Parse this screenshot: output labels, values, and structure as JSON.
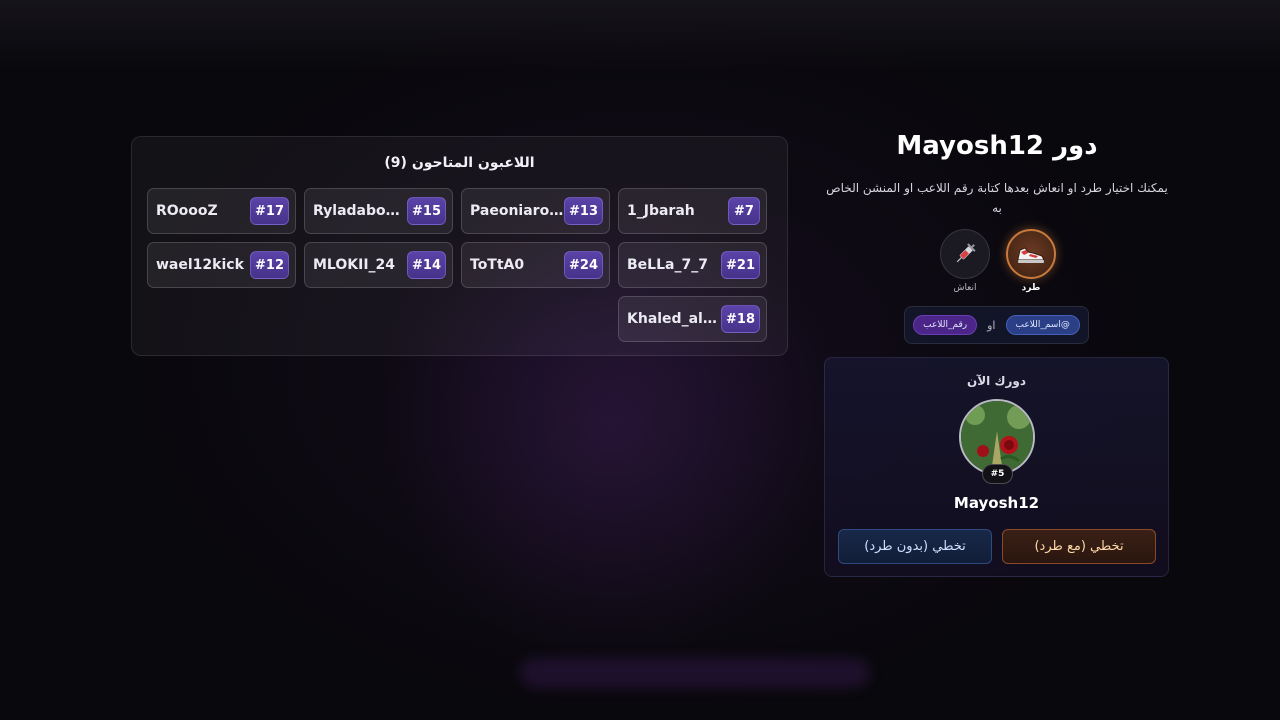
{
  "players_panel": {
    "title": "اللاعبون المتاحون",
    "count": "(9)",
    "players": [
      {
        "name": "1_Jbarah",
        "number": "#7"
      },
      {
        "name": "Paeoniaros…",
        "number": "#13"
      },
      {
        "name": "Ryladaboam…",
        "number": "#15"
      },
      {
        "name": "ROoooZ",
        "number": "#17"
      },
      {
        "name": "BeLLa_7_7",
        "number": "#21"
      },
      {
        "name": "ToTtA0",
        "number": "#24"
      },
      {
        "name": "MLOKII_24",
        "number": "#14"
      },
      {
        "name": "wael12kick",
        "number": "#12"
      },
      {
        "name": "Khaled_alk…",
        "number": "#18"
      }
    ]
  },
  "turn": {
    "prefix": "دور",
    "player": "Mayosh12",
    "instructions": "يمكنك اختيار طرد او انعاش بعدها كتابة رقم اللاعب او المنشن الخاص به"
  },
  "actions": {
    "kick": {
      "label": "طرد",
      "icon": "sneaker-icon"
    },
    "revive": {
      "label": "انعاش",
      "icon": "syringe-icon"
    }
  },
  "hint": {
    "username_chip": "@اسم_اللاعب",
    "or": "او",
    "number_chip": "رقم_اللاعب"
  },
  "current_turn": {
    "heading": "دورك الآن",
    "badge": "#5",
    "name": "Mayosh12",
    "skip_with_kick": "تخطي (مع طرد)",
    "skip_without_kick": "تخطي (بدون طرد)"
  },
  "colors": {
    "accent_purple": "#5b43a8",
    "kick_orange": "#c87a3c",
    "background": "#09080c"
  }
}
